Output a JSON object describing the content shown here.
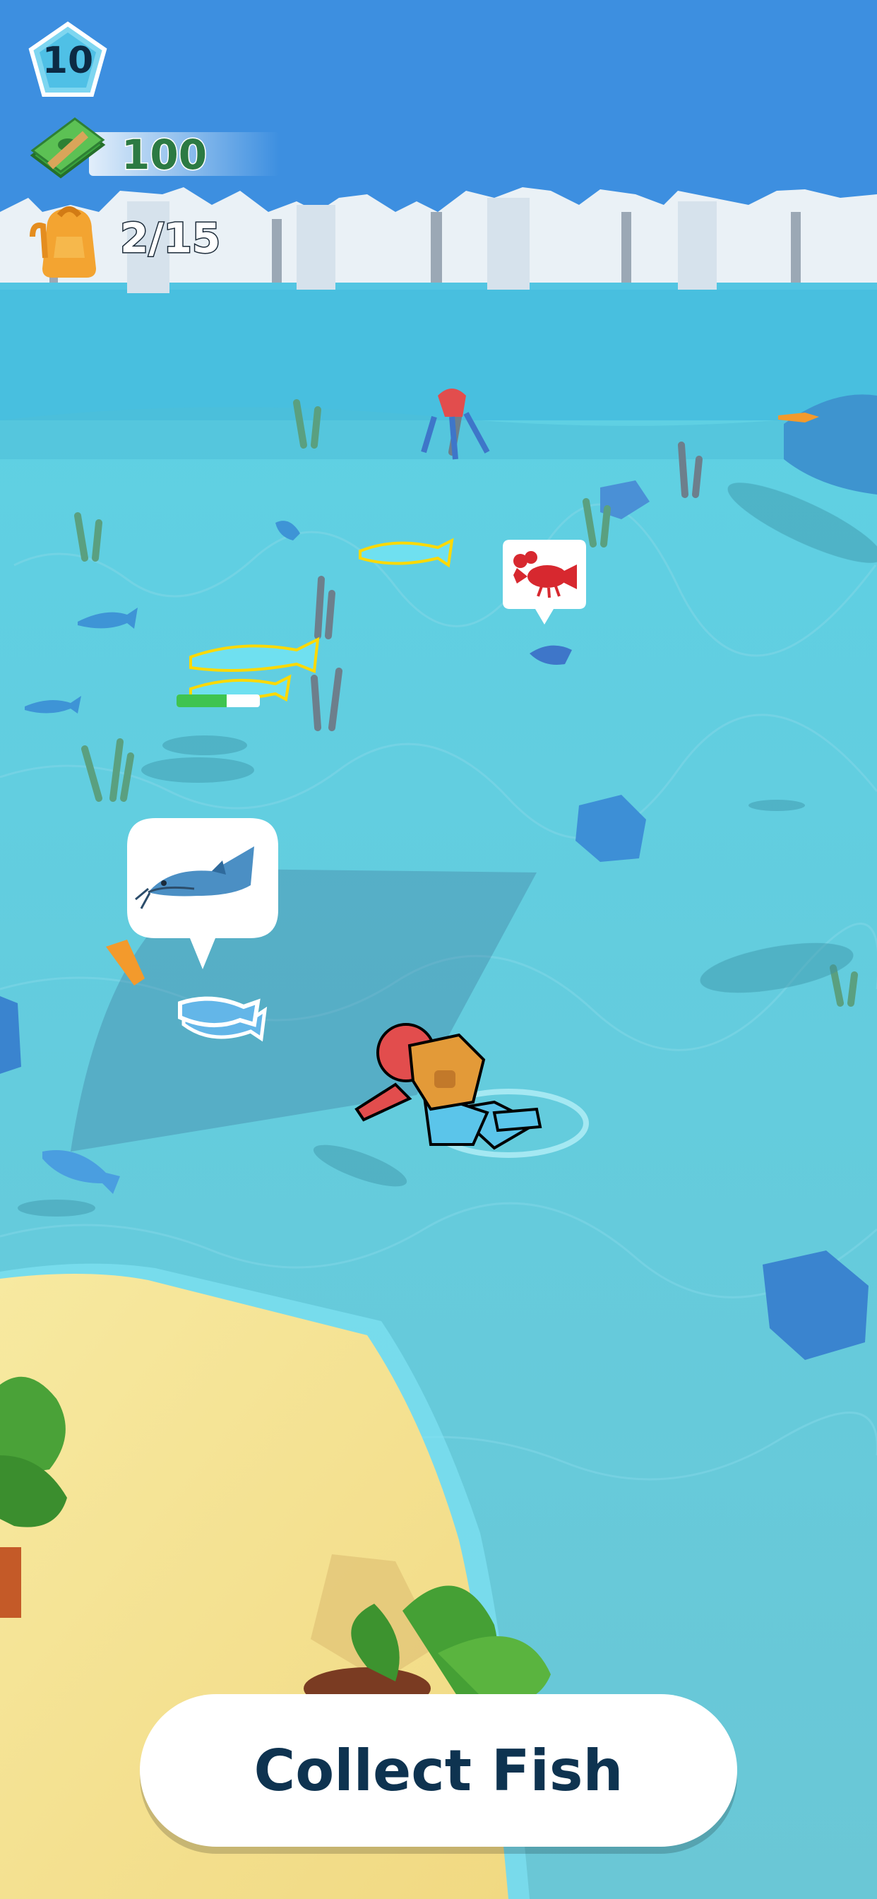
{
  "hud": {
    "level": "10",
    "money": "100",
    "backpack": "2/15",
    "level_icon": "pentagon-badge-icon",
    "money_icon": "cash-stack-icon",
    "bag_icon": "backpack-icon"
  },
  "catch_progress": 0.6,
  "speech_bubbles": [
    {
      "icon": "lobster-icon"
    },
    {
      "icon": "catfish-icon"
    }
  ],
  "collect_button": {
    "label": "Collect Fish"
  },
  "colors": {
    "sky": "#3d8fe0",
    "water": "#59c8dc",
    "sand": "#f6e28e",
    "cliff": "#e8eef3",
    "button_text": "#0e3350"
  }
}
